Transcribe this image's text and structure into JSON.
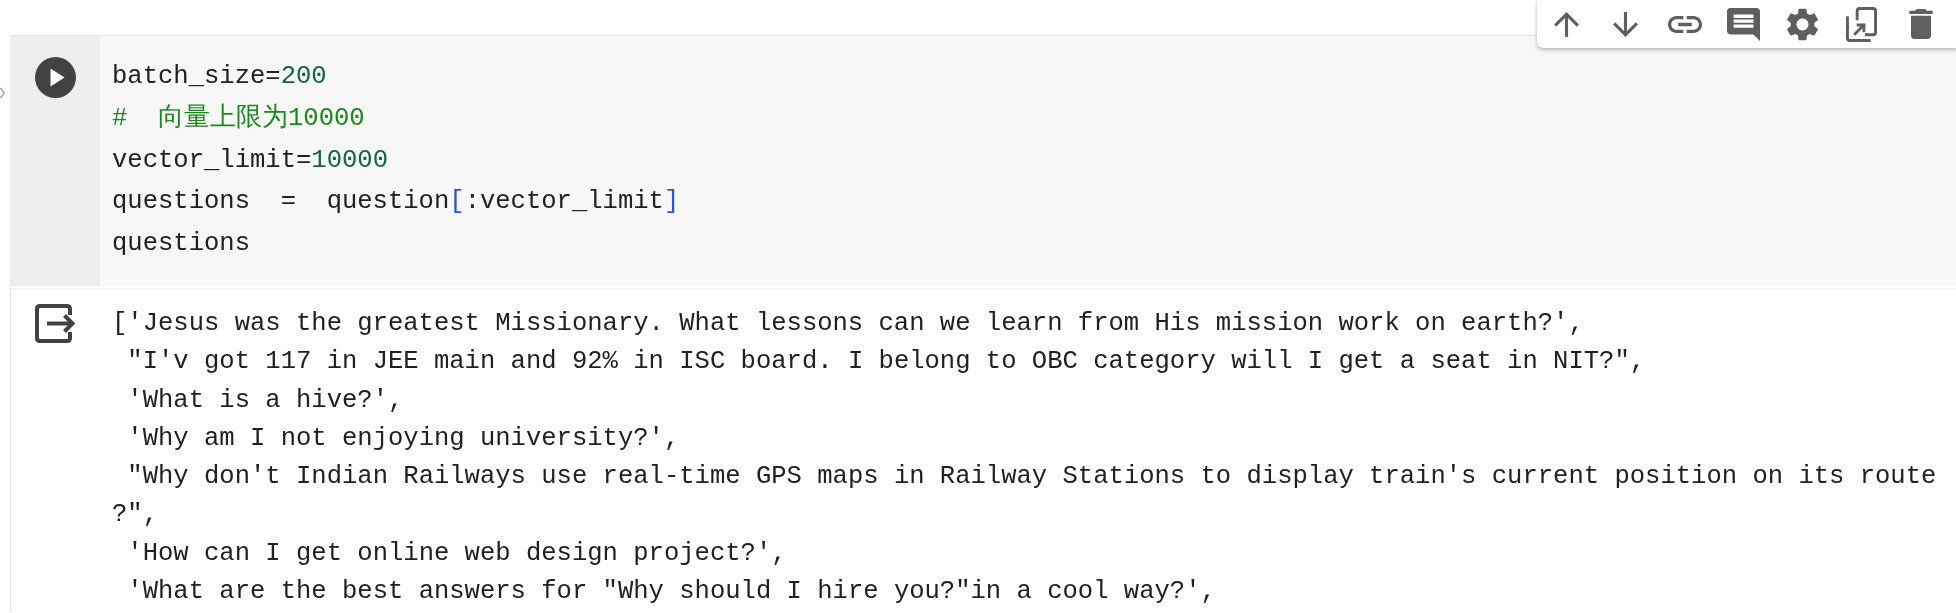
{
  "toolbar": {
    "buttons": [
      {
        "kind": "move_up"
      },
      {
        "kind": "move_down"
      },
      {
        "kind": "link"
      },
      {
        "kind": "comment"
      },
      {
        "kind": "settings"
      },
      {
        "kind": "mirror"
      },
      {
        "kind": "delete"
      }
    ]
  },
  "code_cell": {
    "lines": [
      [
        {
          "text": "batch_size=",
          "kind": "plain"
        },
        {
          "text": "200",
          "kind": "number"
        }
      ],
      [
        {
          "text": "#  向量上限为10000",
          "kind": "comment"
        }
      ],
      [
        {
          "text": "vector_limit=",
          "kind": "plain"
        },
        {
          "text": "10000",
          "kind": "number"
        }
      ],
      [
        {
          "text": "questions  =  question",
          "kind": "plain"
        },
        {
          "text": "[",
          "kind": "bracket"
        },
        {
          "text": ":vector_limit",
          "kind": "plain"
        },
        {
          "text": "]",
          "kind": "bracket"
        }
      ],
      [
        {
          "text": "questions",
          "kind": "plain"
        }
      ]
    ]
  },
  "output": {
    "lines": [
      "['Jesus was the greatest Missionary. What lessons can we learn from His mission work on earth?',",
      " \"I'v got 117 in JEE main and 92% in ISC board. I belong to OBC category will I get a seat in NIT?\",",
      " 'What is a hive?',",
      " 'Why am I not enjoying university?',",
      " \"Why don't Indian Railways use real-time GPS maps in Railway Stations to display train's current position on its route ?\",",
      " 'How can I get online web design project?',",
      " 'What are the best answers for \"Why should I hire you?\"in a cool way?',"
    ]
  }
}
